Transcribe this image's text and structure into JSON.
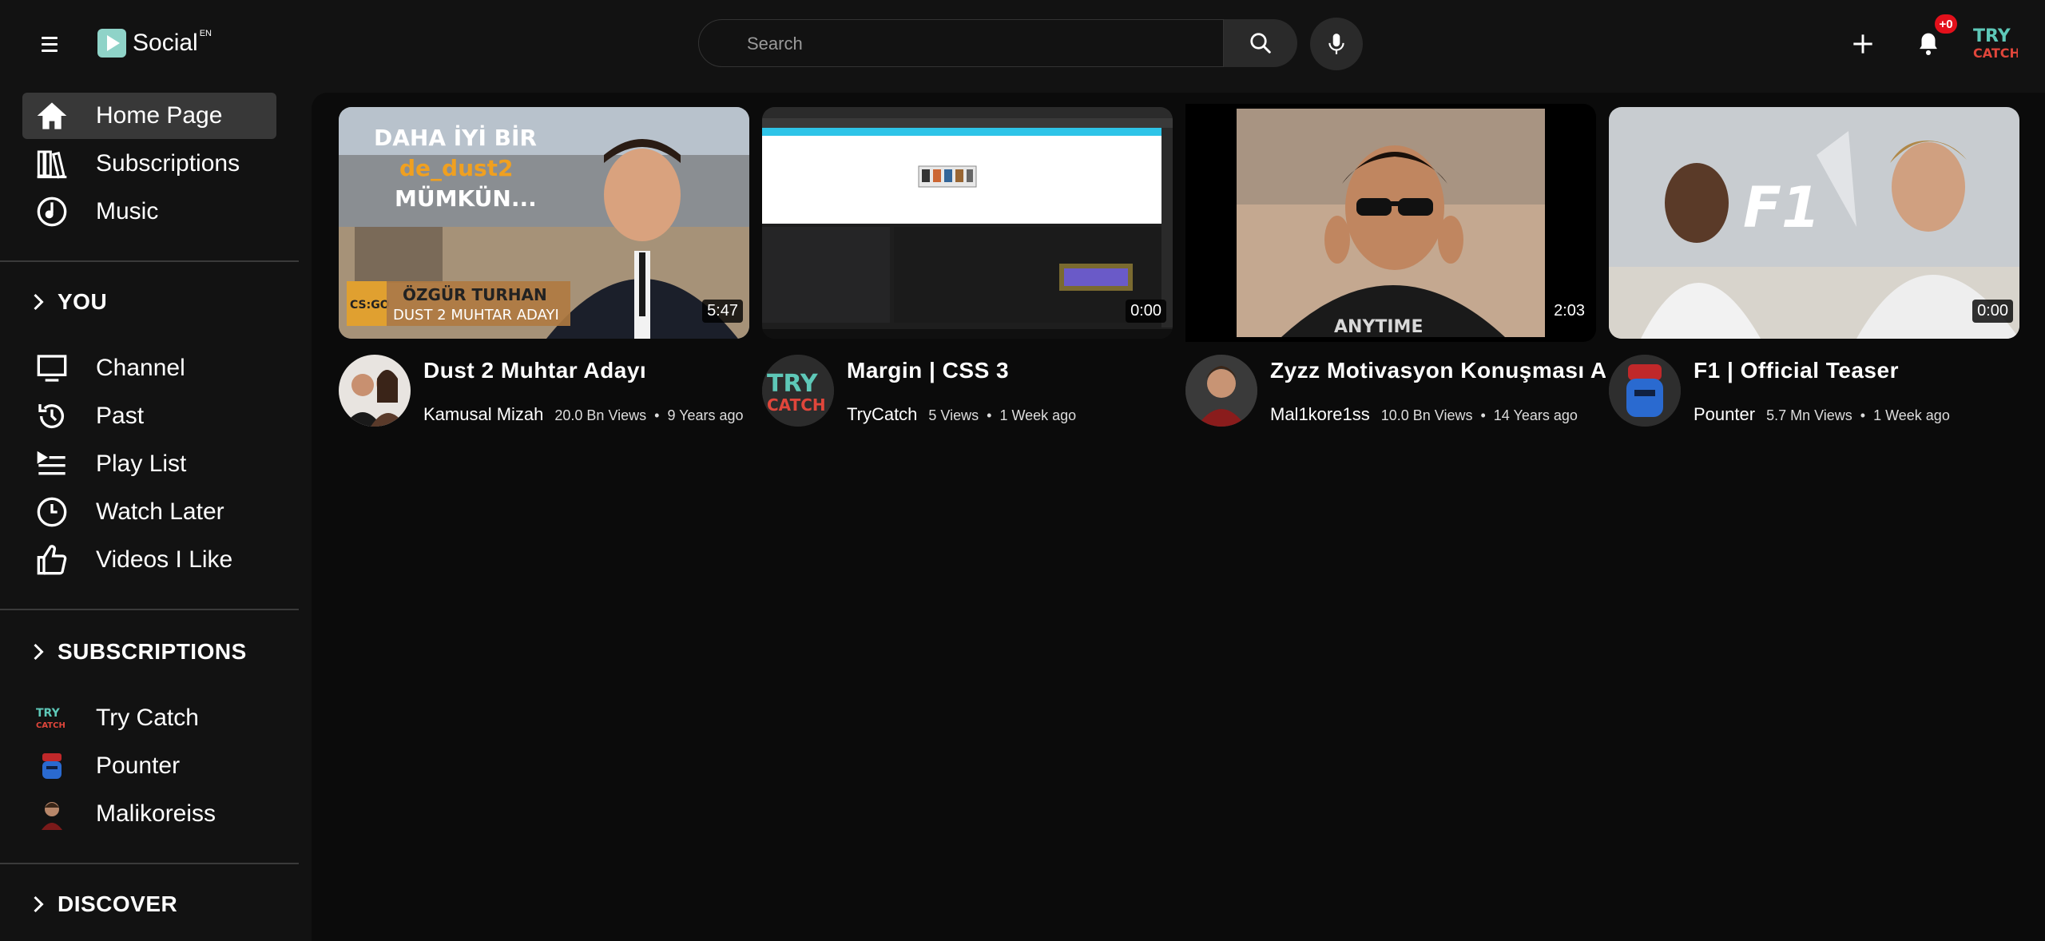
{
  "header": {
    "logo_text": "Social",
    "logo_sup": "EN",
    "search_placeholder": "Search",
    "notification_badge": "+0"
  },
  "sidebar": {
    "main_items": [
      {
        "label": "Home Page",
        "icon": "home-icon",
        "active": true
      },
      {
        "label": "Subscriptions",
        "icon": "library-icon"
      },
      {
        "label": "Music",
        "icon": "music-icon"
      }
    ],
    "you_section": {
      "title": "YOU",
      "items": [
        {
          "label": "Channel",
          "icon": "monitor-icon"
        },
        {
          "label": "Past",
          "icon": "history-icon"
        },
        {
          "label": "Play List",
          "icon": "playlist-icon"
        },
        {
          "label": "Watch Later",
          "icon": "clock-icon"
        },
        {
          "label": "Videos I Like",
          "icon": "thumbs-up-icon"
        }
      ]
    },
    "subscriptions_section": {
      "title": "SUBSCRIPTIONS",
      "items": [
        {
          "label": "Try Catch"
        },
        {
          "label": "Pounter"
        },
        {
          "label": "Malikoreiss"
        }
      ]
    },
    "discover_section": {
      "title": "DISCOVER"
    }
  },
  "videos": [
    {
      "title": "Dust 2 Muhtar Adayı",
      "channel": "Kamusal Mizah",
      "views": "20.0 Bn Views",
      "age": "9 Years ago",
      "duration": "5:47",
      "thumb_text": {
        "line1": "DAHA İYİ BİR",
        "line2": "de_dust2",
        "line3": "MÜMKÜN...",
        "banner1": "ÖZGÜR TURHAN",
        "banner2": "DUST 2 MUHTAR ADAYI",
        "badge": "CS:GO"
      }
    },
    {
      "title": "Margin | CSS 3",
      "channel": "TryCatch",
      "views": "5 Views",
      "age": "1 Week ago",
      "duration": "0:00"
    },
    {
      "title": "Zyzz Motivasyon Konuşması A",
      "channel": "Mal1kore1ss",
      "views": "10.0 Bn Views",
      "age": "14 Years ago",
      "duration": "2:03",
      "thumb_text": {
        "shirt": "ANYTIME"
      }
    },
    {
      "title": "F1 | Official Teaser",
      "channel": "Pounter",
      "views": "5.7 Mn Views",
      "age": "1 Week ago",
      "duration": "0:00",
      "thumb_text": {
        "logo": "F1"
      }
    }
  ],
  "brand_colors": {
    "accent": "#8fd3c8",
    "badge": "#e3101b",
    "active_bg": "#383838"
  }
}
